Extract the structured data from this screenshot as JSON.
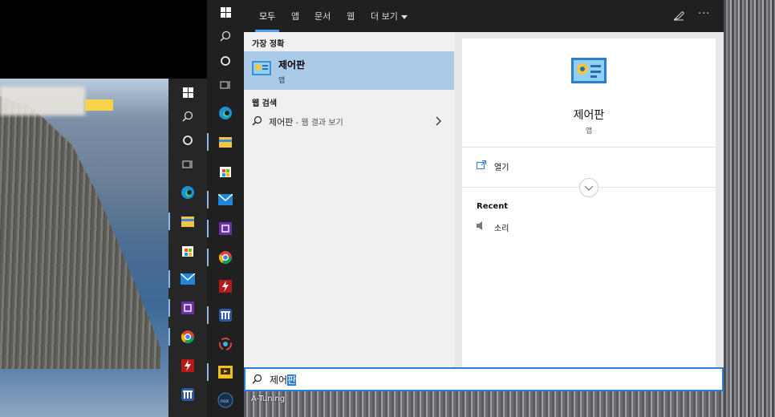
{
  "search_tabs": {
    "all": "모두",
    "apps": "앱",
    "documents": "문서",
    "web": "웹",
    "more": "더 보기"
  },
  "results": {
    "best_match_header": "가장 정확",
    "best_match": {
      "title": "제어판",
      "subtitle": "앱"
    },
    "web_search_header": "웹 검색",
    "web_search": {
      "query": "제어판",
      "suffix": " - 웹 결과 보기"
    }
  },
  "detail": {
    "title": "제어판",
    "subtitle": "앱",
    "open_label": "열기",
    "recent_header": "Recent",
    "recent_items": [
      {
        "label": "소리"
      }
    ]
  },
  "search": {
    "typed": "제어",
    "selected": "판"
  },
  "caption": "A-Tuning",
  "colors": {
    "accent": "#2a7fd4",
    "best_match_bg": "#a9cbe8",
    "taskbar": "#202020"
  },
  "taskbar_icons": [
    "windows-icon",
    "search-icon",
    "cortana-icon",
    "task-view-icon",
    "edge-icon",
    "file-explorer-icon",
    "store-icon",
    "mail-icon",
    "app-icon",
    "chrome-icon",
    "lightning-app-icon",
    "tuning-app-icon",
    "sync-app-icon",
    "yellow-app-icon",
    "nox-icon"
  ]
}
